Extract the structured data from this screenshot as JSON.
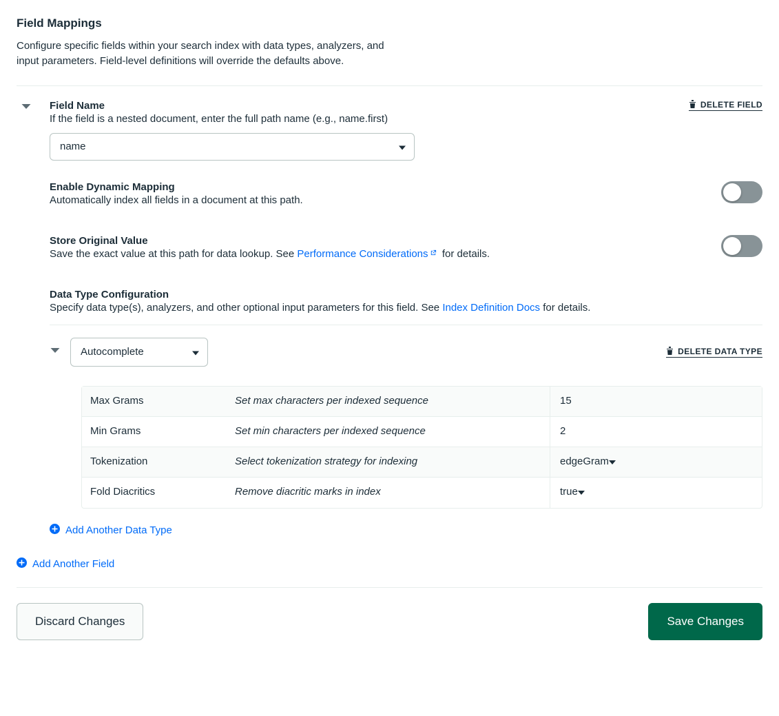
{
  "header": {
    "title": "Field Mappings",
    "desc": "Configure specific fields within your search index with data types, analyzers, and input parameters. Field-level definitions will override the defaults above."
  },
  "field": {
    "name_label": "Field Name",
    "name_hint": "If the field is a nested document, enter the full path name (e.g., name.first)",
    "name_value": "name",
    "delete_field": "DELETE FIELD",
    "dyn_label": "Enable Dynamic Mapping",
    "dyn_desc": "Automatically index all fields in a document at this path.",
    "store_label": "Store Original Value",
    "store_desc_pre": "Save the exact value at this path for data lookup. See ",
    "store_link": "Performance Considerations",
    "store_desc_post": " for details.",
    "dt_label": "Data Type Configuration",
    "dt_desc_pre": "Specify data type(s), analyzers, and other optional input parameters for this field. See ",
    "dt_link": "Index Definition Docs",
    "dt_desc_post": " for details."
  },
  "data_type": {
    "selected": "Autocomplete",
    "delete": "DELETE DATA TYPE",
    "params": [
      {
        "name": "Max Grams",
        "desc": "Set max characters per indexed sequence",
        "value": "15",
        "select": false
      },
      {
        "name": "Min Grams",
        "desc": "Set min characters per indexed sequence",
        "value": "2",
        "select": false
      },
      {
        "name": "Tokenization",
        "desc": "Select tokenization strategy for indexing",
        "value": "edgeGram",
        "select": true
      },
      {
        "name": "Fold Diacritics",
        "desc": "Remove diacritic marks in index",
        "value": "true",
        "select": true
      }
    ],
    "add_dt": "Add Another Data Type"
  },
  "add_field": "Add Another Field",
  "footer": {
    "discard": "Discard Changes",
    "save": "Save Changes"
  }
}
